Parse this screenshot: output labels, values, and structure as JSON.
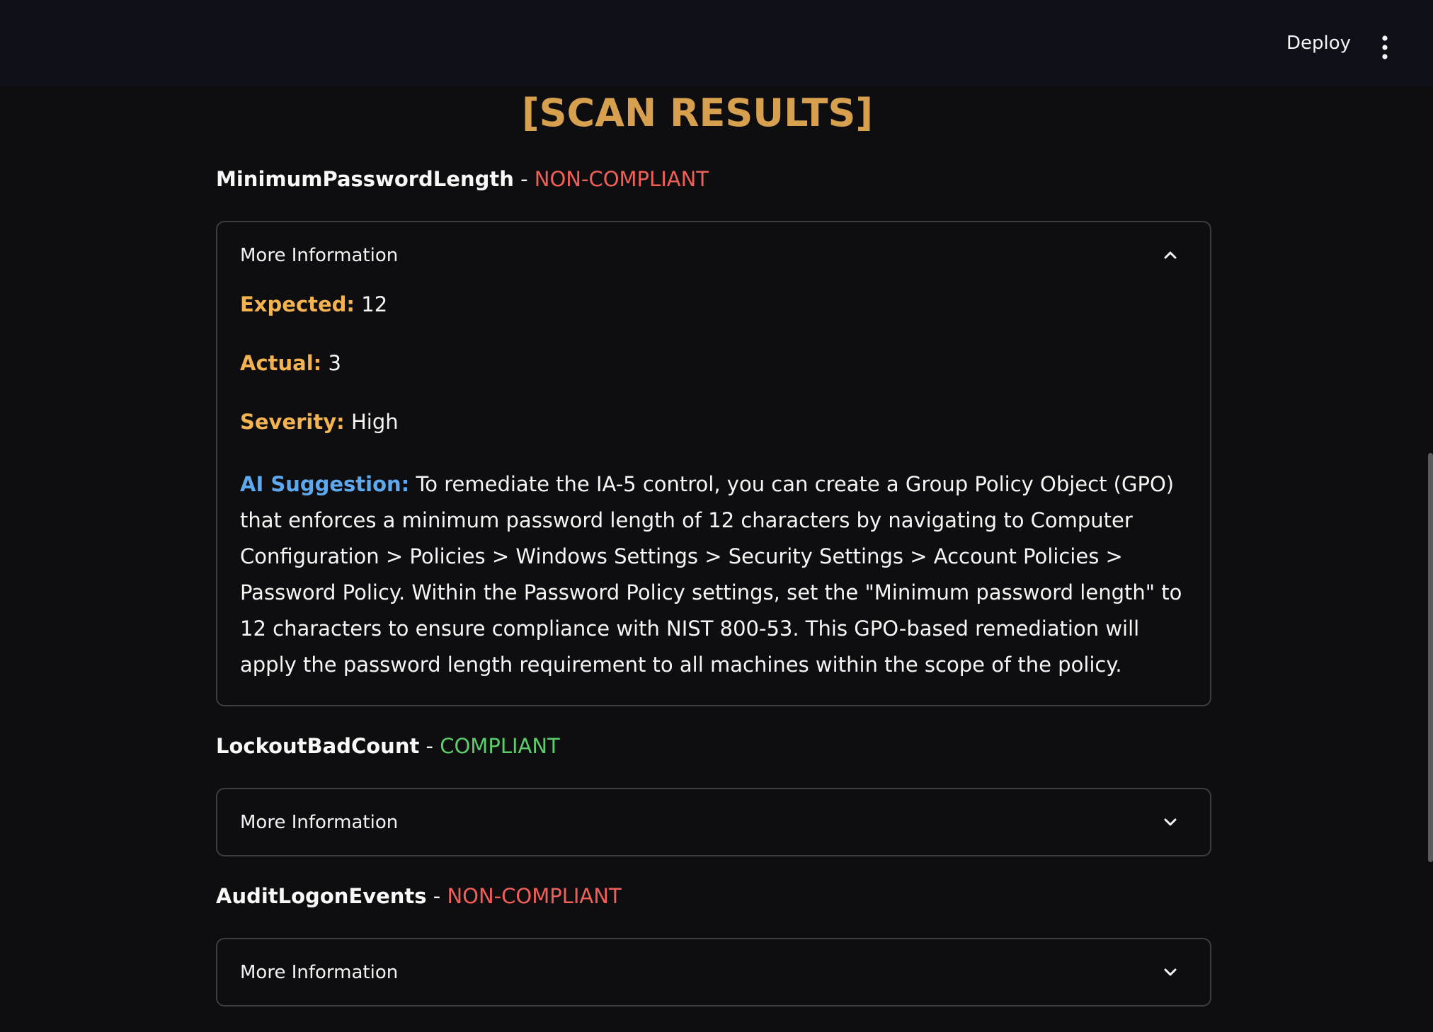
{
  "header": {
    "deploy_label": "Deploy",
    "menu_icon": "kebab-vertical-icon"
  },
  "page": {
    "title": "[SCAN RESULTS]"
  },
  "colors": {
    "title": "#d6a04f",
    "non_compliant": "#f06058",
    "compliant": "#5ccd6a",
    "field_label": "#f2b350",
    "ai_label": "#5ea8ee"
  },
  "results": [
    {
      "name": "MinimumPasswordLength",
      "separator": "-",
      "status": "NON-COMPLIANT",
      "expander": {
        "label": "More Information",
        "expanded": true,
        "chevron_icon": "chevron-up-icon",
        "expected_label": "Expected:",
        "expected_value": "12",
        "actual_label": "Actual:",
        "actual_value": "3",
        "severity_label": "Severity:",
        "severity_value": "High",
        "ai_label": "AI Suggestion:",
        "ai_text": "To remediate the IA-5 control, you can create a Group Policy Object (GPO) that enforces a minimum password length of 12 characters by navigating to Computer Configuration > Policies > Windows Settings > Security Settings > Account Policies > Password Policy. Within the Password Policy settings, set the \"Minimum password length\" to 12 characters to ensure compliance with NIST 800-53. This GPO-based remediation will apply the password length requirement to all machines within the scope of the policy."
      }
    },
    {
      "name": "LockoutBadCount",
      "separator": "-",
      "status": "COMPLIANT",
      "expander": {
        "label": "More Information",
        "expanded": false,
        "chevron_icon": "chevron-down-icon"
      }
    },
    {
      "name": "AuditLogonEvents",
      "separator": "-",
      "status": "NON-COMPLIANT",
      "expander": {
        "label": "More Information",
        "expanded": false,
        "chevron_icon": "chevron-down-icon"
      }
    }
  ]
}
